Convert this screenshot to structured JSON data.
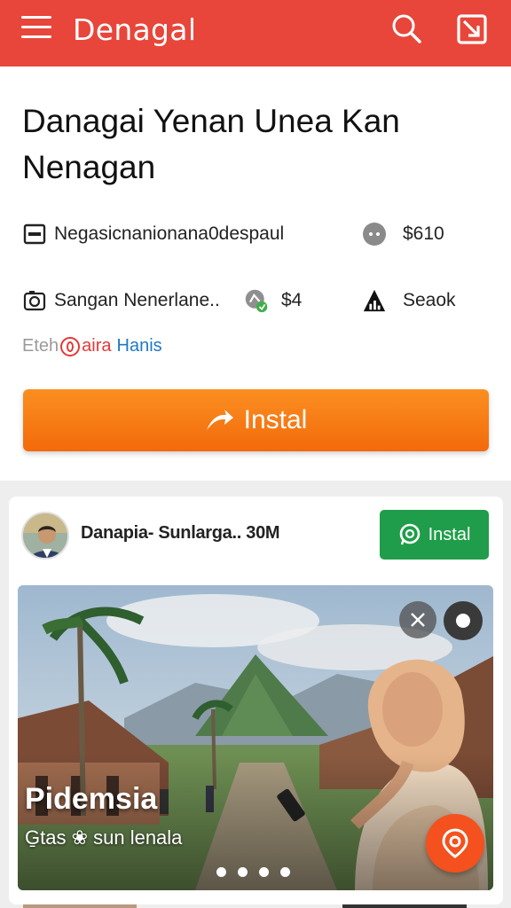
{
  "topbar": {
    "title": "Denagal",
    "menu_icon": "hamburger-menu-icon",
    "search_icon": "search-icon",
    "share_icon": "external-share-icon",
    "background_color": "#e8463a"
  },
  "app": {
    "title": "Danagai Yenan Unea Kan Nenagan",
    "meta": [
      {
        "icon": "card-icon",
        "text": "Negasicnanionana0despaul"
      },
      {
        "icon": "face-icon",
        "text": "$610"
      },
      {
        "icon": "camera-icon",
        "text": "Sangan Nenerlane.."
      },
      {
        "icon": "rating-icon",
        "text": "$4"
      },
      {
        "icon": "chart-warning-icon",
        "text": "Seaok"
      }
    ],
    "byline": {
      "part1": "Eteh",
      "part2": "aira",
      "part3": "Hanis"
    },
    "install_label": "Instal",
    "install_color": "#f57c13"
  },
  "post": {
    "author": "Danapia- Sunlarga.. 30M",
    "install_label": "Instal",
    "install_color": "#1f9d4a",
    "media": {
      "title": "Pidemsia",
      "subtitle": "G̱tas ❀ sun lenala",
      "dots": 4
    }
  }
}
